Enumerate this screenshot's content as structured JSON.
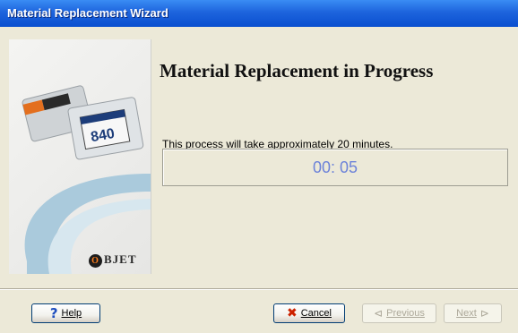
{
  "window": {
    "title": "Material Replacement Wizard"
  },
  "main": {
    "heading": "Material Replacement in Progress",
    "description": "This process will take approximately 20 minutes.",
    "timer": "00: 05"
  },
  "side_panel": {
    "logo_text": "BJET",
    "logo_mark": "O",
    "cartridge_label": "840"
  },
  "buttons": {
    "help": "Help",
    "cancel": "Cancel",
    "previous": "Previous",
    "next": "Next"
  },
  "icons": {
    "help": "question-mark-icon",
    "cancel": "red-x-icon",
    "previous": "arrow-left-icon",
    "next": "arrow-right-icon"
  },
  "colors": {
    "titlebar": "#1d64dd",
    "timer_text": "#6d83d9",
    "background": "#ece9d8"
  }
}
